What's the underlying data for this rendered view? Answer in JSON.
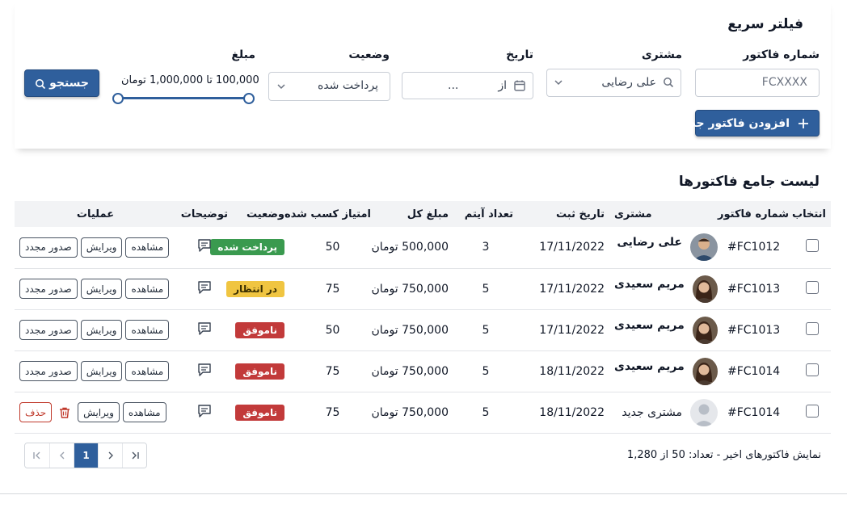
{
  "filter": {
    "title": "فیلتر سریع",
    "invoice_number": {
      "label": "شماره فاکتور",
      "placeholder": "FCXXXX"
    },
    "customer": {
      "label": "مشتری",
      "value": "علی رضایی"
    },
    "date": {
      "label": "تاریخ",
      "from_label": "از",
      "value": "..."
    },
    "status": {
      "label": "وضعیت",
      "value": "پرداخت شده"
    },
    "amount": {
      "label": "مبلغ",
      "range_text": "100,000 تا 1,000,000 تومان",
      "min_fraction": 0.0,
      "max_fraction": 1.0
    },
    "search_label": "جستجو",
    "add_label": "افزودن فاکتور جدید"
  },
  "list": {
    "title": "لیست جامع فاکتورها",
    "columns": [
      "انتخاب",
      "شماره فاکتور",
      "مشتری",
      "تاریخ ثبت",
      "تعداد آیتم",
      "مبلغ کل",
      "امتیاز کسب شده",
      "وضعیت",
      "توضیحات",
      "عملیات"
    ],
    "actions": {
      "view": "مشاهده",
      "edit": "ویرایش",
      "reissue": "صدور مجدد",
      "delete": "حذف"
    },
    "rows": [
      {
        "invoice": "#FC1012",
        "customer": "علی رضایی",
        "avatar": "male",
        "date": "17/11/2022",
        "items": "3",
        "amount": "500,000 تومان",
        "points": "50",
        "status": "پرداخت شده",
        "status_color": "#3a9a4f",
        "deletable": false
      },
      {
        "invoice": "#FC1013",
        "customer": "مریم سعیدی",
        "avatar": "female",
        "date": "17/11/2022",
        "items": "5",
        "amount": "750,000 تومان",
        "points": "75",
        "status": "در انتظار",
        "status_color": "#f0c541",
        "deletable": false
      },
      {
        "invoice": "#FC1013",
        "customer": "مریم سعیدی",
        "avatar": "female",
        "date": "17/11/2022",
        "items": "5",
        "amount": "750,000 تومان",
        "points": "50",
        "status": "ناموفق",
        "status_color": "#c23a3a",
        "deletable": false
      },
      {
        "invoice": "#FC1014",
        "customer": "مریم سعیدی",
        "avatar": "female",
        "date": "18/11/2022",
        "items": "5",
        "amount": "750,000 تومان",
        "points": "75",
        "status": "ناموفق",
        "status_color": "#c23a3a",
        "deletable": false
      },
      {
        "invoice": "#FC1014",
        "customer": "مشتری جدید",
        "avatar": "placeholder",
        "date": "18/11/2022",
        "items": "5",
        "amount": "750,000 تومان",
        "points": "75",
        "status": "ناموفق",
        "status_color": "#c23a3a",
        "deletable": true
      }
    ]
  },
  "footer": {
    "summary": "نمایش فاکتورهای اخیر - تعداد: 50 از 1,280",
    "current_page": "1",
    "pager_icons": [
      "first-page-icon",
      "prev-page-icon",
      "next-page-icon",
      "last-page-icon"
    ]
  },
  "colors": {
    "primary": "#2f5f9c",
    "success": "#3a9a4f",
    "warning": "#f0c541",
    "danger": "#c23a3a"
  }
}
